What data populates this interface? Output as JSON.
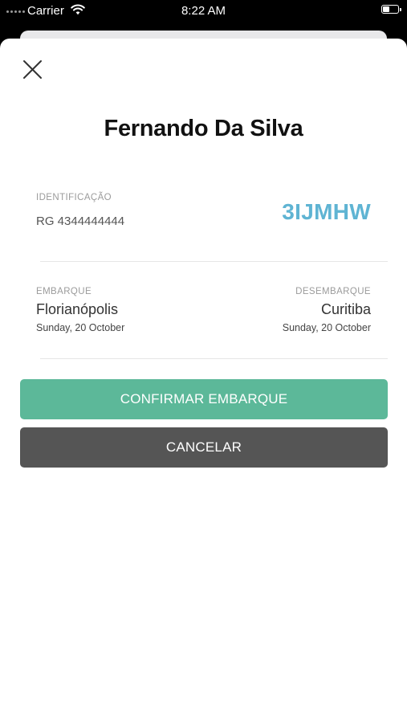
{
  "status_bar": {
    "carrier": "Carrier",
    "time": "8:22 AM"
  },
  "passenger": {
    "name": "Fernando Da Silva"
  },
  "identification": {
    "label": "IDENTIFICAÇÃO",
    "value": "RG 4344444444",
    "booking_code": "3IJMHW"
  },
  "trip": {
    "boarding": {
      "label": "EMBARQUE",
      "city": "Florianópolis",
      "date": "Sunday, 20 October"
    },
    "landing": {
      "label": "DESEMBARQUE",
      "city": "Curitiba",
      "date": "Sunday, 20 October"
    }
  },
  "actions": {
    "confirm_label": "CONFIRMAR EMBARQUE",
    "cancel_label": "CANCELAR"
  },
  "colors": {
    "accent_code": "#5fb4d3",
    "confirm_button": "#5cb899",
    "cancel_button": "#555555"
  },
  "icons": {
    "close": "close-icon",
    "wifi": "wifi-icon",
    "battery": "battery-icon",
    "signal": "signal-icon"
  }
}
